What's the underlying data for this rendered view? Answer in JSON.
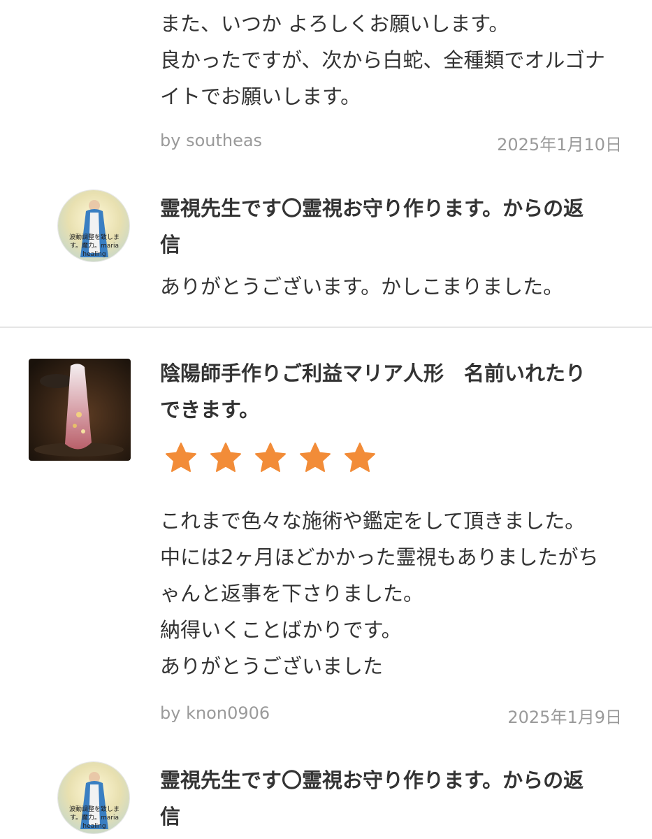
{
  "top_review": {
    "lines": [
      "また、いつか よろしくお願いします。",
      "良かったですが、次から白蛇、全種類でオルゴナ",
      "イトでお願いします。"
    ],
    "author": "by southeas",
    "date": "2025年1月10日"
  },
  "reply_1": {
    "avatar_text": [
      "波動調整を致しま",
      "す。魔力。maria",
      "healing"
    ],
    "title_lines": [
      "霊視先生です〇霊視お守り作ります。からの返",
      "信"
    ],
    "body": "ありがとうございます。かしこまりました。"
  },
  "review_2": {
    "product_title_lines": [
      "陰陽師手作りご利益マリア人形　名前いれたり",
      "できます。"
    ],
    "rating": 5,
    "rating_max": 5,
    "star_color": "#f28c38",
    "lines": [
      "これまで色々な施術や鑑定をして頂きました。",
      "中には2ヶ月ほどかかった霊視もありましたがち",
      "ゃんと返事を下さりました。",
      "納得いくことばかりです。",
      "ありがとうございました"
    ],
    "author": "by knon0906",
    "date": "2025年1月9日"
  },
  "reply_2": {
    "avatar_text": [
      "波動調整を致しま",
      "す。魔力。maria",
      "healing"
    ],
    "title_lines": [
      "霊視先生です〇霊視お守り作ります。からの返",
      "信"
    ]
  }
}
